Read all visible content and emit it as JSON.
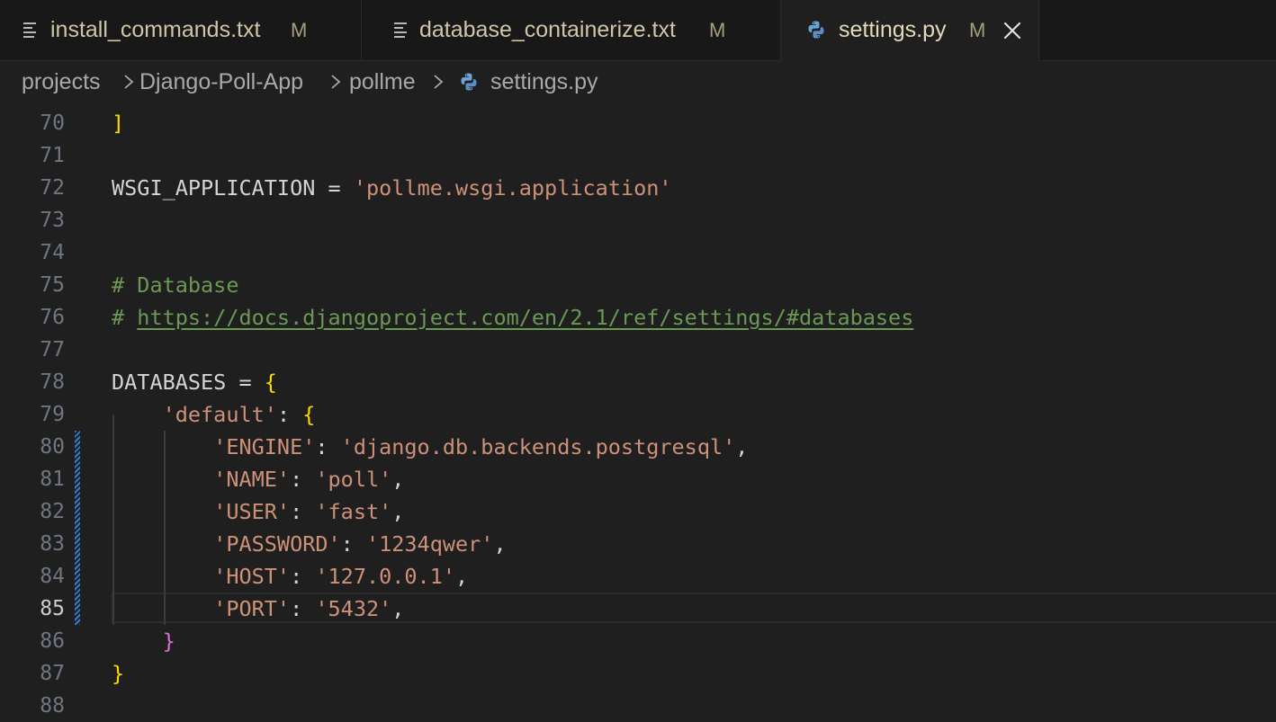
{
  "tabs": [
    {
      "label": "install_commands.txt",
      "modified": "M",
      "icon": "text-file-icon"
    },
    {
      "label": "database_containerize.txt",
      "modified": "M",
      "icon": "text-file-icon"
    },
    {
      "label": "settings.py",
      "modified": "M",
      "icon": "python-file-icon",
      "active": true
    }
  ],
  "breadcrumb": [
    "projects",
    "Django-Poll-App",
    "pollme",
    "settings.py"
  ],
  "editor": {
    "current_line": 85,
    "lines": [
      {
        "n": "70",
        "text": "]"
      },
      {
        "n": "71",
        "text": ""
      },
      {
        "n": "72",
        "text": "WSGI_APPLICATION = 'pollme.wsgi.application'"
      },
      {
        "n": "73",
        "text": ""
      },
      {
        "n": "74",
        "text": ""
      },
      {
        "n": "75",
        "text": "# Database"
      },
      {
        "n": "76",
        "text": "# https://docs.djangoproject.com/en/2.1/ref/settings/#databases"
      },
      {
        "n": "77",
        "text": ""
      },
      {
        "n": "78",
        "text": "DATABASES = {"
      },
      {
        "n": "79",
        "text": "    'default': {"
      },
      {
        "n": "80",
        "text": "        'ENGINE': 'django.db.backends.postgresql',"
      },
      {
        "n": "81",
        "text": "        'NAME': 'poll',"
      },
      {
        "n": "82",
        "text": "        'USER': 'fast',"
      },
      {
        "n": "83",
        "text": "        'PASSWORD': '1234qwer',"
      },
      {
        "n": "84",
        "text": "        'HOST': '127.0.0.1',"
      },
      {
        "n": "85",
        "text": "        'PORT': '5432',"
      },
      {
        "n": "86",
        "text": "    }"
      },
      {
        "n": "87",
        "text": "}"
      },
      {
        "n": "88",
        "text": ""
      }
    ]
  },
  "colors": {
    "string": "#ce9178",
    "comment": "#6a9955",
    "bracket_level1": "#ffd700",
    "bracket_level2": "#da70d6",
    "modified_gutter": "#2f7bd8"
  }
}
